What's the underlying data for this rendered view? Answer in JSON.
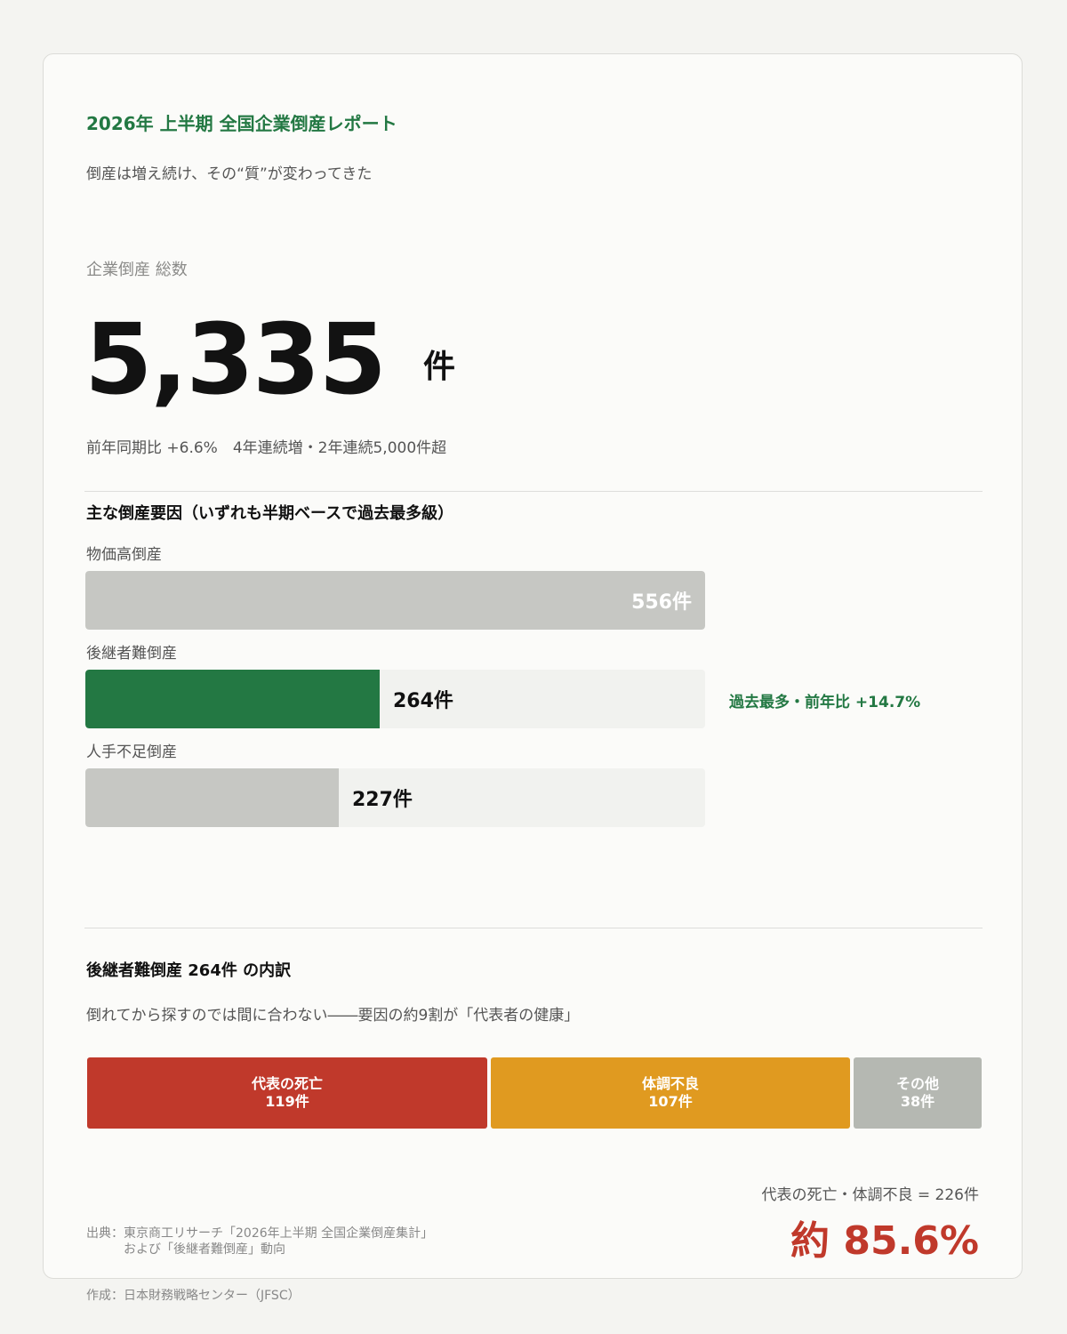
{
  "header": {
    "title": "2026年 上半期  全国企業倒産レポート",
    "subtitle": "倒産は増え続け、その“質”が変わってきた"
  },
  "total": {
    "label": "企業倒産 総数",
    "value": "5,335",
    "unit": "件",
    "note": "前年同期比 +6.6%　4年連続増・2年連続5,000件超"
  },
  "causes": {
    "heading": "主な倒産要因（いずれも半期ベースで過去最多級）",
    "note": "過去最多・前年比 +14.7%"
  },
  "breakdown": {
    "heading": "後継者難倒産 264件 の内訳",
    "description": "倒れてから探すのでは間に合わない――要因の約9割が「代表者の健康」"
  },
  "summary": {
    "label": "代表の死亡・体調不良 = 226件",
    "value": "約 85.6%"
  },
  "footer": {
    "source_line1": "出典：東京商工リサーチ「2026年上半期 全国企業倒産集計」",
    "source_line2": "　　　および「後継者難倒産」動向",
    "author": "作成：日本財務戦略センター（JFSC）"
  },
  "colors": {
    "accent_green": "#237843",
    "bar_gray": "#c6c7c3",
    "track": "#f1f2ef",
    "red": "#c0392b",
    "orange": "#e09a20",
    "other_gray": "#b5b8b2"
  },
  "chart_data": [
    {
      "type": "bar",
      "orientation": "horizontal",
      "categories": [
        "物価高倒産",
        "後継者難倒産",
        "人手不足倒産"
      ],
      "values": [
        556,
        264,
        227
      ],
      "value_labels": [
        "556件",
        "264件",
        "227件"
      ],
      "highlight": "後継者難倒産",
      "xlim": [
        0,
        556
      ]
    },
    {
      "type": "bar",
      "orientation": "stacked-horizontal",
      "categories": [
        "代表の死亡",
        "体調不良",
        "その他"
      ],
      "values": [
        119,
        107,
        38
      ],
      "value_labels": [
        "119件",
        "107件",
        "38件"
      ],
      "total": 264
    }
  ]
}
